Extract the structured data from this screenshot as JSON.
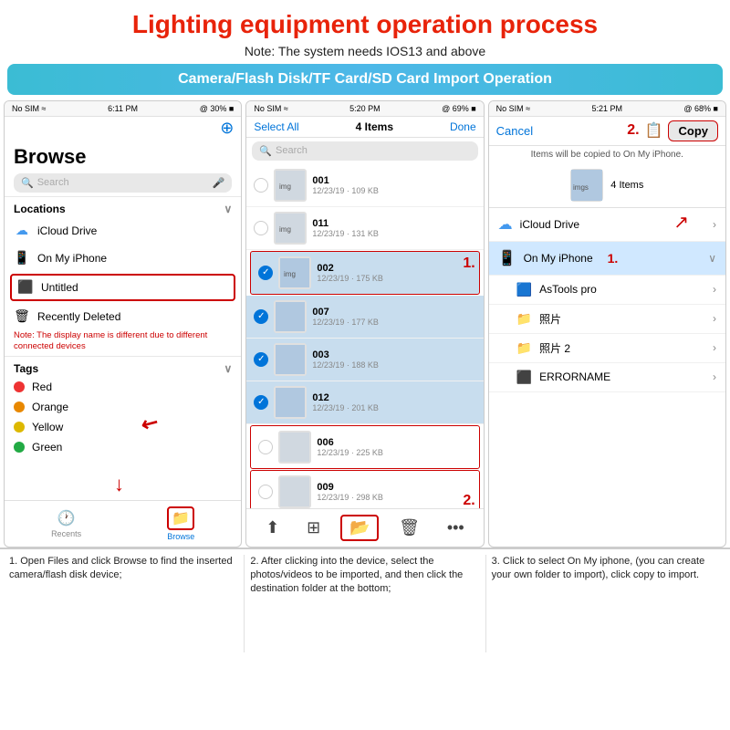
{
  "header": {
    "title": "Lighting equipment operation process",
    "subtitle": "Note: The system needs IOS13 and above",
    "banner": "Camera/Flash Disk/TF Card/SD Card Import Operation"
  },
  "screen1": {
    "status": {
      "left": "No SIM ≈",
      "time": "6:11 PM",
      "right": "@ 30% ■"
    },
    "browse_label": "Browse",
    "search_placeholder": "Search",
    "sections": {
      "locations_label": "Locations",
      "locations": [
        {
          "icon": "☁",
          "name": "iCloud Drive",
          "color": "#4499ee"
        },
        {
          "icon": "📱",
          "name": "On My iPhone",
          "color": "#555"
        },
        {
          "icon": "⬛",
          "name": "Untitled",
          "color": "#888",
          "highlighted": true
        },
        {
          "icon": "🗑",
          "name": "Recently Deleted",
          "color": "#888"
        }
      ],
      "deleted_note": "Note: The display name is different due to different connected devices",
      "tags_label": "Tags",
      "tags": [
        {
          "color": "#e33",
          "name": "Red"
        },
        {
          "color": "#e88800",
          "name": "Orange"
        },
        {
          "color": "#ddb800",
          "name": "Yellow"
        },
        {
          "color": "#22aa44",
          "name": "Green"
        }
      ]
    },
    "bottom": [
      {
        "icon": "🕐",
        "label": "Recents",
        "active": false
      },
      {
        "icon": "📁",
        "label": "Browse",
        "active": true
      }
    ]
  },
  "screen2": {
    "status": {
      "left": "No SIM ≈",
      "time": "5:20 PM",
      "right": "@ 69% ■"
    },
    "select_all": "Select All",
    "count": "4 Items",
    "done": "Done",
    "search_placeholder": "Search",
    "files": [
      {
        "name": "001",
        "date": "12/23/19 · 109 KB",
        "selected": false,
        "highlighted": false
      },
      {
        "name": "011",
        "date": "12/23/19 · 131 KB",
        "selected": false,
        "highlighted": false
      },
      {
        "name": "002",
        "date": "12/23/19 · 175 KB",
        "selected": true,
        "highlighted": false
      },
      {
        "name": "007",
        "date": "12/23/19 · 177 KB",
        "selected": true,
        "highlighted": false
      },
      {
        "name": "003",
        "date": "12/23/19 · 188 KB",
        "selected": true,
        "highlighted": false
      },
      {
        "name": "012",
        "date": "12/23/19 · 201 KB",
        "selected": true,
        "highlighted": false
      },
      {
        "name": "006",
        "date": "12/23/19 · 225 KB",
        "selected": false,
        "highlighted": true
      },
      {
        "name": "009",
        "date": "12/23/19 · 298 KB",
        "selected": false,
        "highlighted": true
      }
    ],
    "annotation1": "1.",
    "annotation2": "2."
  },
  "screen3": {
    "status": {
      "left": "No SIM ≈",
      "time": "5:21 PM",
      "right": "@ 68% ■"
    },
    "cancel": "Cancel",
    "annotation2": "2.",
    "copy_btn": "Copy",
    "copy_note": "Items will be copied to On My iPhone.",
    "items_count": "4 Items",
    "locations": [
      {
        "icon": "☁",
        "name": "iCloud Drive",
        "type": "cloud",
        "chevron": "",
        "selected": false
      },
      {
        "icon": "📱",
        "name": "On My iPhone",
        "type": "phone",
        "chevron": "∨",
        "selected": true
      }
    ],
    "sub_items": [
      {
        "icon": "🟦",
        "name": "AsTools pro",
        "chevron": "›"
      },
      {
        "icon": "📁",
        "name": "照片",
        "chevron": "›"
      },
      {
        "icon": "📁",
        "name": "照片 2",
        "chevron": "›"
      },
      {
        "icon": "⬛",
        "name": "ERRORNAME",
        "chevron": "›"
      }
    ],
    "annotation1": "1."
  },
  "descriptions": [
    "1. Open Files and click Browse to find the inserted camera/flash disk device;",
    "2. After clicking into the device, select the photos/videos to be imported, and then click the destination folder at the bottom;",
    "3. Click to select On My iphone, (you can create your own folder to import), click copy to import."
  ]
}
